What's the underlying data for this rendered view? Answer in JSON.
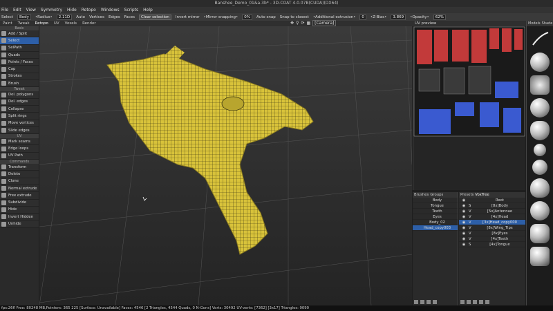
{
  "titlebar": {
    "title": "Banshee_Demo_01&a.3b* - 3D-COAT 4.0.07B(CUDA)(DX64)"
  },
  "menu": [
    "File",
    "Edit",
    "View",
    "Symmetry",
    "Hide",
    "Retopo",
    "Windows",
    "Scripts",
    "Help"
  ],
  "toolbar": {
    "select": "Select",
    "body": "Body",
    "radius": "•Radius•",
    "radius_val": "2.11D",
    "auto": "Auto",
    "vertices": "Vertices",
    "edges": "Edges",
    "faces": "Faces",
    "clear_selection": "Clear selection",
    "invert_mirror": "Invert mirror",
    "mirror_snapping": "•Mirror snapping•",
    "mirror_val": "0%",
    "auto_snap": "Auto snap",
    "snap_to_closest": "Snap to closest",
    "additional_extrusion": "•Additional extrusion•",
    "extrusion_val": "0",
    "zbias": "•Z-Bias•",
    "zbias_val": "3.869",
    "opacity": "•Opacity•",
    "opacity_val": "62%"
  },
  "tabs": [
    "Paint",
    "Tweak",
    "Retopo",
    "UV",
    "Voxels",
    "Render"
  ],
  "viewport_tools": {
    "camera": "[Camera]"
  },
  "uv_panel": {
    "title": "UV preview"
  },
  "left_tools": {
    "sections": {
      "basic": "Basic",
      "tweak": "Tweak",
      "uv": "UV",
      "commands": "Commands"
    },
    "basic": [
      "Add / Split",
      "Select",
      "SelPath",
      "Quads",
      "Points / Faces",
      "Cap",
      "Strokes",
      "Brush"
    ],
    "tweak": [
      "Del. polygons",
      "Del. edges",
      "Collapse",
      "Split rings",
      "Move vertices",
      "Slide edges"
    ],
    "uv": [
      "Mark seams",
      "Edge loops",
      "UV Path"
    ],
    "commands": [
      "Transform",
      "Delete",
      "Clone",
      "Normal extrude",
      "Free extrude",
      "Subdivide",
      "Hide",
      "Invert Hidden",
      "Unhide"
    ]
  },
  "brush_panel": {
    "tabs": [
      "Brushes",
      "Groups"
    ],
    "items": [
      "Body",
      "Tongue",
      "Teeth",
      "Eyes",
      "Body_02",
      "Head_copy003"
    ]
  },
  "vox_panel": {
    "tabs": [
      "Presets",
      "VoxTree"
    ],
    "items": [
      {
        "flag": "",
        "name": "Root"
      },
      {
        "flag": "S",
        "name": "[8x]Body"
      },
      {
        "flag": "V",
        "name": "[5x]Antennae"
      },
      {
        "flag": "V",
        "name": "[4x]Head"
      },
      {
        "flag": "V",
        "name": "[3x]Head_copy000"
      },
      {
        "flag": "V",
        "name": "[8x]Wing_Tips"
      },
      {
        "flag": "V",
        "name": "[8x]Eyes"
      },
      {
        "flag": "V",
        "name": "[4x]Teeth"
      },
      {
        "flag": "S",
        "name": "[4x]Tongue"
      }
    ]
  },
  "right_panel": {
    "tabs": [
      "Models",
      "Shade"
    ]
  },
  "statusbar": {
    "text": "fps:26fl    Free: 80248 MB,Pointers: 365 225  [Surface: Unavailable]  Faces: 4546 [2 Triangles, 4544 Quads, 0 N-Gons] Verts: 30492  UV-verts: [7362] [3x17]  Triangles: 9090"
  },
  "colors": {
    "accent": "#2d5fa8",
    "mesh_yellow": "#d8c23a",
    "uv_red": "#c23a3a",
    "uv_blue": "#3a5ad0"
  }
}
